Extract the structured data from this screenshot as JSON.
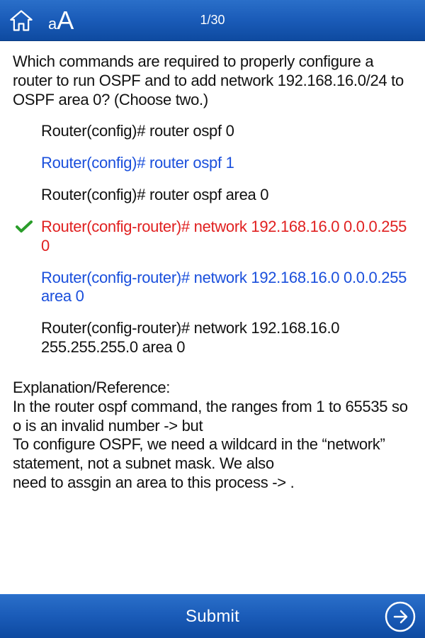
{
  "header": {
    "counter": "1/30"
  },
  "question": "Which commands are required to properly configure a router to run OSPF and to add network 192.168.16.0/24 to OSPF area 0? (Choose two.)",
  "answers": [
    {
      "text": "Router(config)# router ospf 0",
      "state": "default",
      "checked": false
    },
    {
      "text": "Router(config)# router ospf 1",
      "state": "selected",
      "checked": false
    },
    {
      "text": "Router(config)# router ospf area 0",
      "state": "default",
      "checked": false
    },
    {
      "text": "Router(config-router)# network 192.168.16.0 0.0.0.255 0",
      "state": "wrong",
      "checked": true
    },
    {
      "text": "Router(config-router)# network 192.168.16.0 0.0.0.255 area 0",
      "state": "selected",
      "checked": false
    },
    {
      "text": "Router(config-router)# network 192.168.16.0 255.255.255.0 area 0",
      "state": "default",
      "checked": false
    }
  ],
  "explanation": "Explanation/Reference:\nIn the router ospf command, the ranges from 1 to 65535 so o is an invalid number -> but\nTo configure OSPF, we need a wildcard in the “network” statement, not a subnet mask. We also\nneed to assgin an area to this process -> .",
  "footer": {
    "submit_label": "Submit"
  }
}
